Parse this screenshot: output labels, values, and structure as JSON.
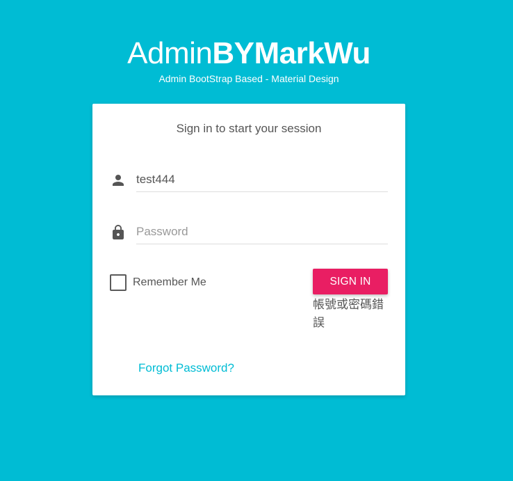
{
  "logo": {
    "title_light": "Admin",
    "title_bold": "BYMarkWu",
    "subtitle": "Admin BootStrap Based - Material Design"
  },
  "login": {
    "message": "Sign in to start your session",
    "username_value": "test444",
    "username_icon": "person-icon",
    "password_placeholder": "Password",
    "password_icon": "lock-icon",
    "remember_label": "Remember Me",
    "remember_checked": false,
    "signin_label": "SIGN IN",
    "error_text": "帳號或密碼錯誤",
    "forgot_label": "Forgot Password?"
  },
  "colors": {
    "background": "#00bcd4",
    "button": "#e91e63",
    "link": "#00bcd4"
  }
}
